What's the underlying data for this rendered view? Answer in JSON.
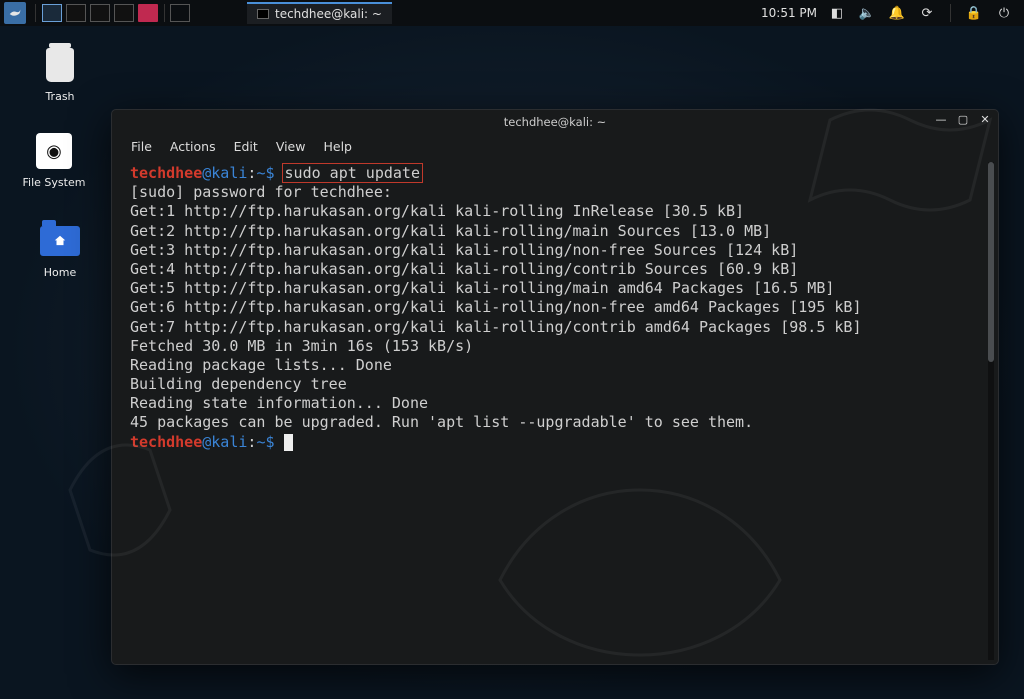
{
  "panel": {
    "clock": "10:51 PM",
    "taskbar_app_title": "techdhee@kali: ~"
  },
  "desktop": {
    "trash_label": "Trash",
    "filesystem_label": "File System",
    "home_label": "Home"
  },
  "terminal": {
    "title": "techdhee@kali: ~",
    "menus": {
      "file": "File",
      "actions": "Actions",
      "edit": "Edit",
      "view": "View",
      "help": "Help"
    },
    "prompt": {
      "user": "techdhee",
      "at": "@",
      "host": "kali",
      "sep": ":",
      "path": "~",
      "dollar": "$"
    },
    "command": "sudo apt update",
    "output": "[sudo] password for techdhee:\nGet:1 http://ftp.harukasan.org/kali kali-rolling InRelease [30.5 kB]\nGet:2 http://ftp.harukasan.org/kali kali-rolling/main Sources [13.0 MB]\nGet:3 http://ftp.harukasan.org/kali kali-rolling/non-free Sources [124 kB]\nGet:4 http://ftp.harukasan.org/kali kali-rolling/contrib Sources [60.9 kB]\nGet:5 http://ftp.harukasan.org/kali kali-rolling/main amd64 Packages [16.5 MB]\nGet:6 http://ftp.harukasan.org/kali kali-rolling/non-free amd64 Packages [195 kB]\nGet:7 http://ftp.harukasan.org/kali kali-rolling/contrib amd64 Packages [98.5 kB]\nFetched 30.0 MB in 3min 16s (153 kB/s)\nReading package lists... Done\nBuilding dependency tree\nReading state information... Done\n45 packages can be upgraded. Run 'apt list --upgradable' to see them."
  }
}
